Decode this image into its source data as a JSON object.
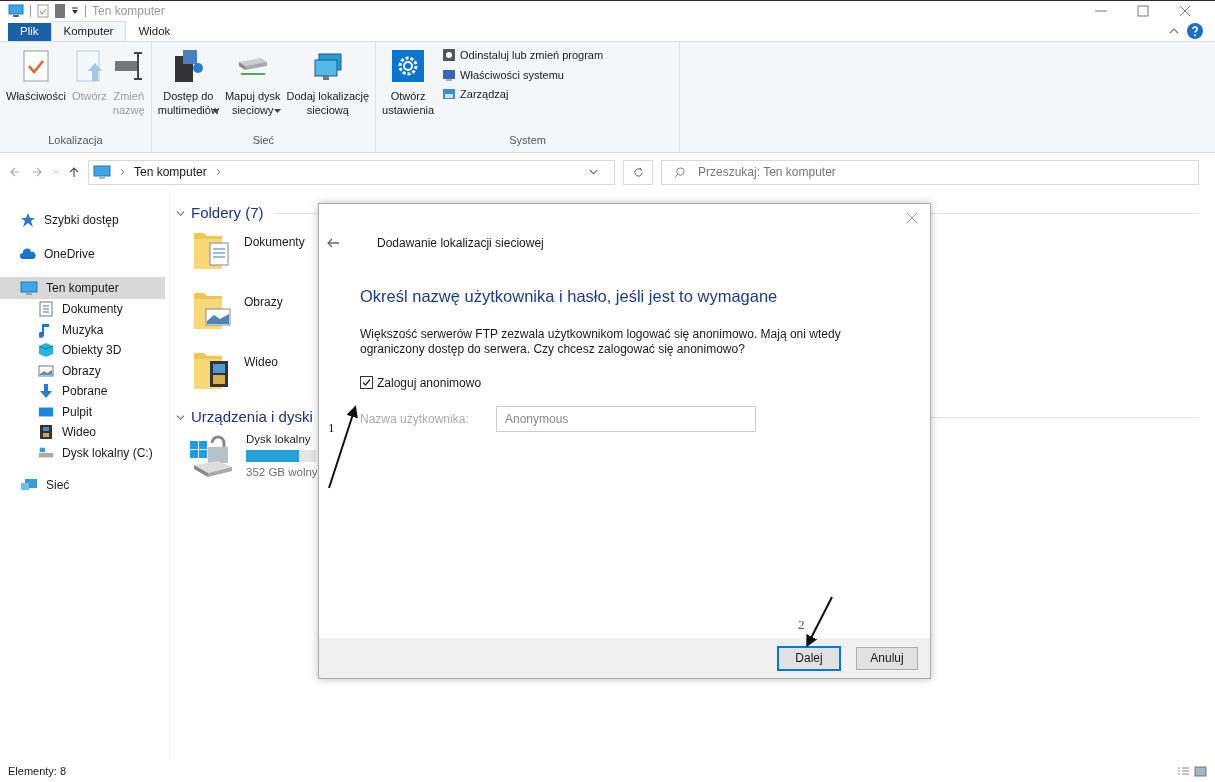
{
  "window": {
    "title": "Ten komputer"
  },
  "ribbon_tabs": [
    {
      "label": "Plik",
      "kind": "file",
      "selected": false
    },
    {
      "label": "Komputer",
      "kind": "tab",
      "selected": true
    },
    {
      "label": "Widok",
      "kind": "tab",
      "selected": false
    }
  ],
  "ribbon_groups": [
    {
      "label": "Lokalizacja",
      "buttons": [
        {
          "label": "Właściwości",
          "disabled": false,
          "dropdown": false
        },
        {
          "label": "Otwórz",
          "disabled": true,
          "dropdown": false
        },
        {
          "label": "Zmień\nnazwę",
          "disabled": true,
          "dropdown": false
        }
      ]
    },
    {
      "label": "Sieć",
      "buttons": [
        {
          "label": "Dostęp do\nmultimediów",
          "disabled": false,
          "dropdown": true
        },
        {
          "label": "Mapuj dysk\nsieciowy",
          "disabled": false,
          "dropdown": true
        },
        {
          "label": "Dodaj lokalizację\nsieciową",
          "disabled": false,
          "dropdown": false
        }
      ]
    },
    {
      "label": "System",
      "buttons": [
        {
          "label": "Otwórz\nustawienia",
          "disabled": false,
          "dropdown": false
        }
      ],
      "small_buttons": [
        "Odinstaluj lub zmień program",
        "Właściwości systemu",
        "Zarządzaj"
      ]
    }
  ],
  "address_bar": {
    "path": [
      "Ten komputer"
    ]
  },
  "search": {
    "placeholder": "Przeszukaj: Ten komputer"
  },
  "sidebar": {
    "items": [
      {
        "label": "Szybki dostęp",
        "selected": false
      },
      {
        "label": "OneDrive",
        "selected": false
      },
      {
        "label": "Ten komputer",
        "selected": true,
        "children": [
          {
            "label": "Dokumenty"
          },
          {
            "label": "Muzyka"
          },
          {
            "label": "Obiekty 3D"
          },
          {
            "label": "Obrazy"
          },
          {
            "label": "Pobrane"
          },
          {
            "label": "Pulpit"
          },
          {
            "label": "Wideo"
          },
          {
            "label": "Dysk lokalny (C:)"
          }
        ]
      },
      {
        "label": "Sieć",
        "selected": false
      }
    ]
  },
  "sections": [
    {
      "title": "Foldery (7)",
      "expanded": true,
      "items": [
        {
          "name": "Dokumenty",
          "kind": "folder"
        },
        {
          "name": "Obrazy",
          "kind": "folder"
        },
        {
          "name": "Wideo",
          "kind": "folder"
        }
      ]
    },
    {
      "title": "Urządzenia i dyski",
      "expanded": true,
      "items": [
        {
          "name": "Dysk lokalny",
          "kind": "drive",
          "level": 0.75,
          "free": "352 GB wolny"
        }
      ]
    }
  ],
  "status_bar": {
    "items": "Elementy: 8"
  },
  "dialog": {
    "title": "Dodawanie lokalizacji sieciowej",
    "heading": "Określ nazwę użytkownika i hasło, jeśli jest to wymagane",
    "text": "Większość serwerów FTP zezwala użytkownikom logować się anonimowo. Mają oni wtedy ograniczony dostęp do serwera. Czy chcesz zalogować się anonimowo?",
    "checkbox": {
      "label": "Zaloguj anonimowo",
      "checked": true
    },
    "username": {
      "label": "Nazwa użytkownika:",
      "value": "Anonymous",
      "disabled": true
    },
    "buttons": [
      {
        "label": "Dalej",
        "default": true
      },
      {
        "label": "Anuluj",
        "default": false
      }
    ]
  },
  "annotations": [
    {
      "label": "1"
    },
    {
      "label": "2"
    }
  ]
}
